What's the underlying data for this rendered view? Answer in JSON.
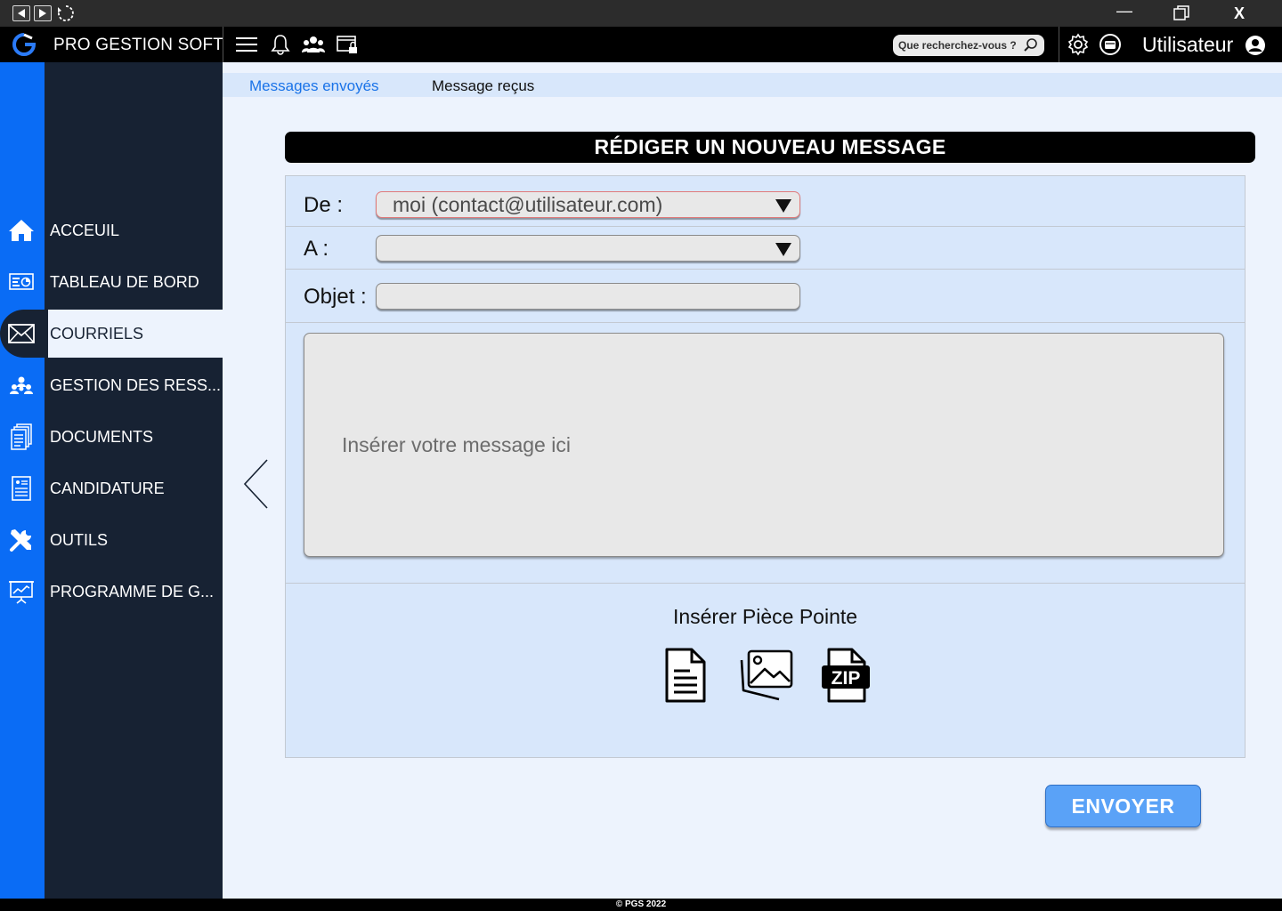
{
  "app": {
    "name": "PRO GESTION SOFT",
    "footer": "© PGS 2022"
  },
  "window": {
    "minimize": "—",
    "close": "X"
  },
  "header": {
    "search_placeholder": "Que recherchez-vous ?",
    "user_label": "Utilisateur"
  },
  "sidebar": {
    "items": [
      {
        "label": "ACCEUIL",
        "icon": "home-icon",
        "active": false
      },
      {
        "label": "TABLEAU DE BORD",
        "icon": "dashboard-icon",
        "active": false
      },
      {
        "label": "COURRIELS",
        "icon": "mail-icon",
        "active": true
      },
      {
        "label": "GESTION DES RESS...",
        "icon": "people-icon",
        "active": false
      },
      {
        "label": "DOCUMENTS",
        "icon": "documents-icon",
        "active": false
      },
      {
        "label": "CANDIDATURE",
        "icon": "application-form-icon",
        "active": false
      },
      {
        "label": "OUTILS",
        "icon": "tools-icon",
        "active": false
      },
      {
        "label": "PROGRAMME DE G...",
        "icon": "presentation-chart-icon",
        "active": false
      }
    ]
  },
  "tabs": {
    "sent": "Messages envoyés",
    "received": "Message reçus"
  },
  "compose": {
    "title": "RÉDIGER UN NOUVEAU MESSAGE",
    "from_label": "De :",
    "from_value": "moi (contact@utilisateur.com)",
    "to_label": "A :",
    "to_value": "",
    "subject_label": "Objet :",
    "subject_value": "",
    "message_placeholder": "Insérer votre message ici",
    "attach_title": "Insérer Pièce Pointe",
    "attach_zip_text": "ZIP",
    "send_label": "ENVOYER"
  },
  "colors": {
    "sidebar_blue": "#0a6cf5",
    "sidebar_dark": "#172233",
    "content_bg": "#edf3fd",
    "panel_bg": "#d8e7fb",
    "link_blue": "#1a73e8",
    "send_button": "#5aa2f7"
  }
}
